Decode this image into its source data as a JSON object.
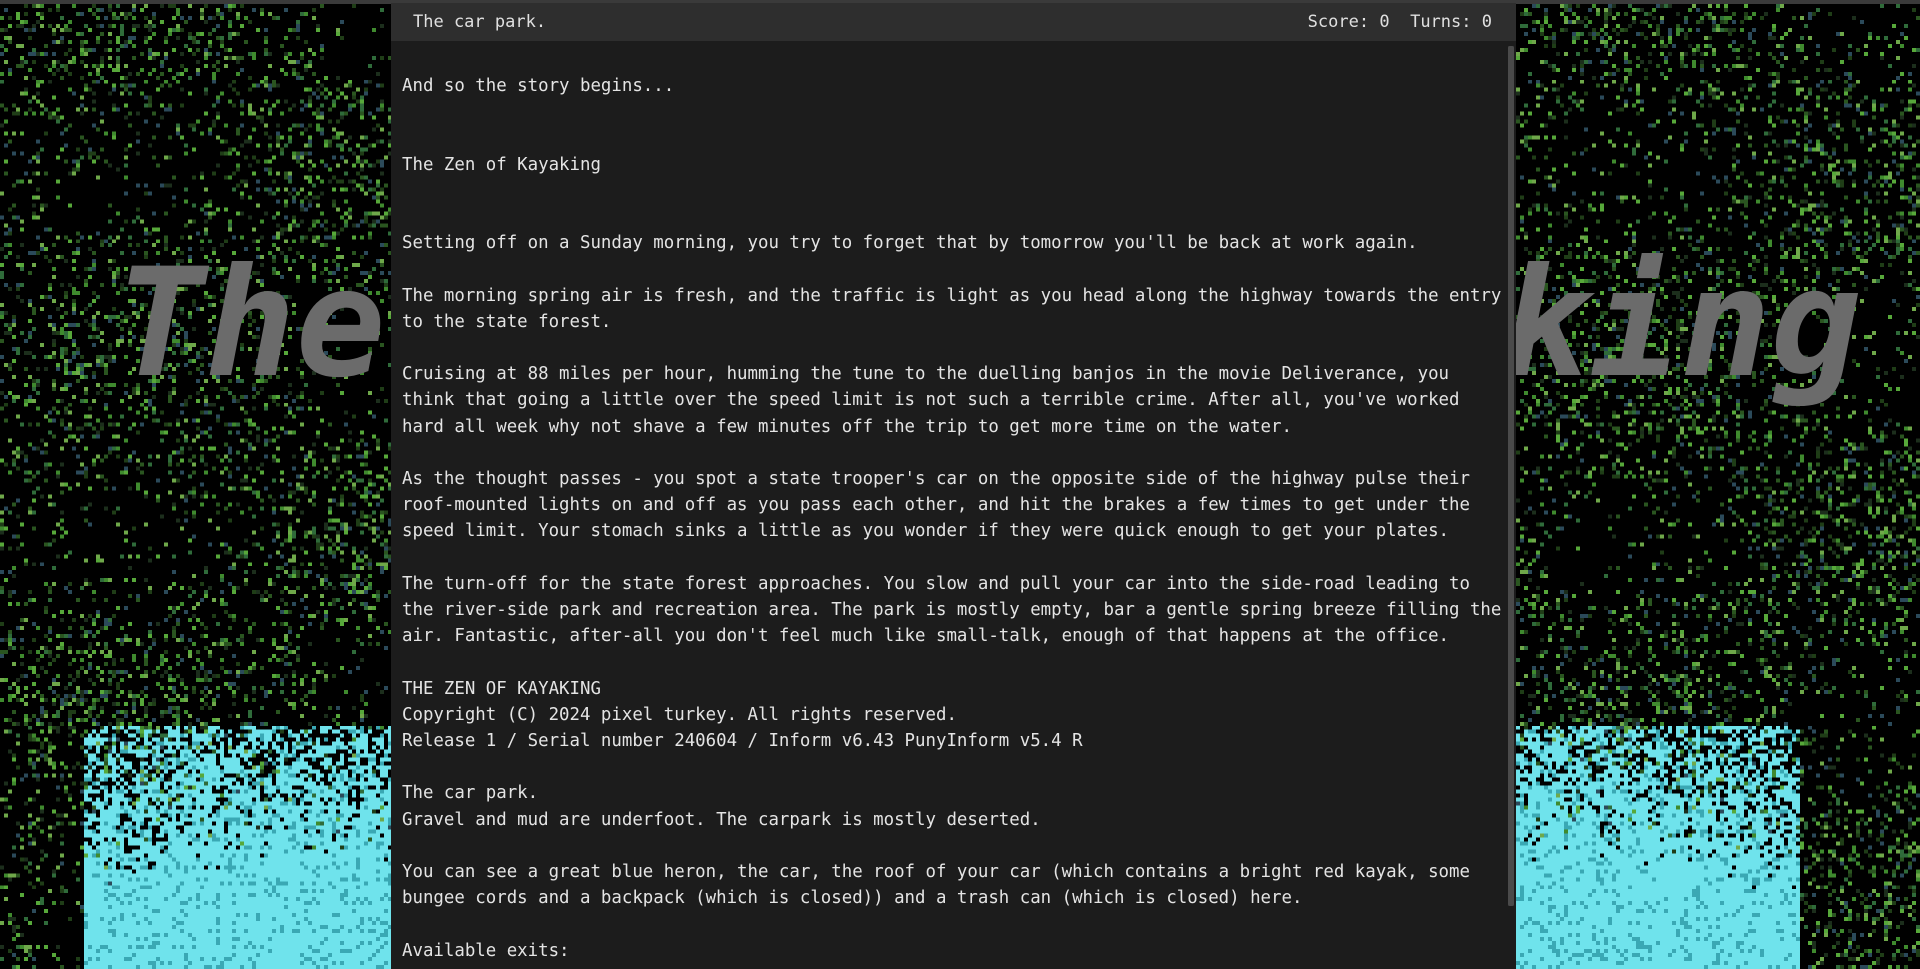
{
  "colors": {
    "page_background": "#000000",
    "window_background": "#1c1c1c",
    "status_bar_background": "#2e2e2e",
    "text": "#e4e4e4",
    "foliage_green": "#3f8a2e",
    "water_cyan": "#6fe3ec",
    "title_art_gray": "#6b6b6b"
  },
  "background": {
    "title_art_left": "The",
    "title_art_right": "king"
  },
  "status": {
    "location": "The car park.",
    "score_label": "Score:",
    "score_value": "0",
    "turns_label": "Turns:",
    "turns_value": "0"
  },
  "transcript": {
    "intro": "And so the story begins...",
    "title": "The Zen of Kayaking",
    "para1": "Setting off on a Sunday morning, you try to forget that by tomorrow you'll be back at work again.",
    "para2": "The morning spring air is fresh, and the traffic is light as you head along the highway towards the entry to the state forest.",
    "para3": "Cruising at 88 miles per hour, humming the tune to the duelling banjos in the movie Deliverance, you think that going a little over the speed limit is not such a terrible crime. After all, you've worked hard all week why not shave a few minutes off the trip to get more time on the water.",
    "para4": "As the thought passes - you spot a state trooper's car on the opposite side of the highway pulse their roof-mounted lights on and off as you pass each other, and hit the brakes a few times to get under the speed limit. Your stomach sinks a little as you wonder if they were quick enough to get your plates.",
    "para5": "The turn-off for the state forest approaches. You slow and pull your car into the side-road leading to the river-side park and recreation area. The park is mostly empty, bar a gentle spring breeze filling the air. Fantastic, after-all you don't feel much like small-talk, enough of that happens at the office.",
    "banner_title": "THE ZEN OF KAYAKING",
    "banner_copyright": "Copyright (C) 2024 pixel turkey. All rights reserved.",
    "banner_release": "Release 1 / Serial number 240604 / Inform v6.43 PunyInform v5.4 R",
    "room_name": "The car park.",
    "room_description": "Gravel and mud are underfoot. The carpark is mostly deserted.",
    "objects": "You can see a great blue heron, the car, the roof of your car (which contains a bright red kayak, some bungee cords and a backpack (which is closed)) and a trash can (which is closed) here.",
    "exits_label": "Available exits:"
  }
}
